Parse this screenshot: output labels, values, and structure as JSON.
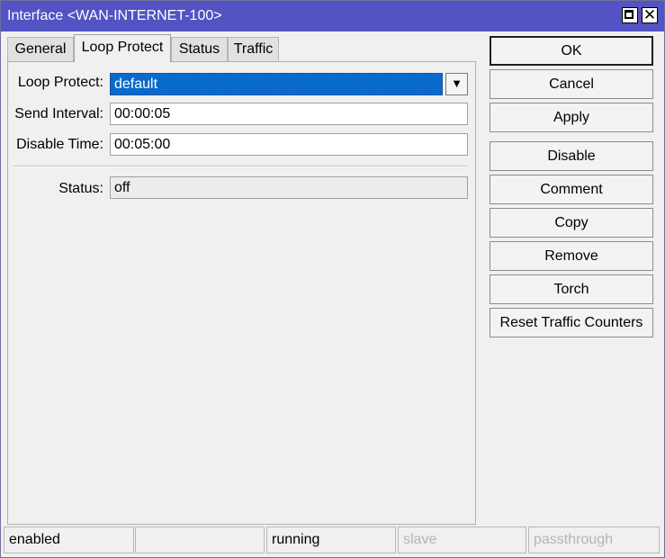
{
  "window": {
    "title": "Interface <WAN-INTERNET-100>"
  },
  "tabs": [
    {
      "label": "General"
    },
    {
      "label": "Loop Protect"
    },
    {
      "label": "Status"
    },
    {
      "label": "Traffic"
    }
  ],
  "form": {
    "loop_protect": {
      "label": "Loop Protect:",
      "value": "default"
    },
    "send_interval": {
      "label": "Send Interval:",
      "value": "00:00:05"
    },
    "disable_time": {
      "label": "Disable Time:",
      "value": "00:05:00"
    },
    "status": {
      "label": "Status:",
      "value": "off"
    }
  },
  "buttons": {
    "ok": "OK",
    "cancel": "Cancel",
    "apply": "Apply",
    "disable": "Disable",
    "comment": "Comment",
    "copy": "Copy",
    "remove": "Remove",
    "torch": "Torch",
    "reset_traffic_counters": "Reset Traffic Counters"
  },
  "statusbar": {
    "enabled": "enabled",
    "empty": "",
    "running": "running",
    "slave": "slave",
    "passthrough": "passthrough"
  },
  "colors": {
    "titlebar": "#5353c3",
    "selection": "#0a6acc",
    "dim_text": "#b4b4b4"
  }
}
